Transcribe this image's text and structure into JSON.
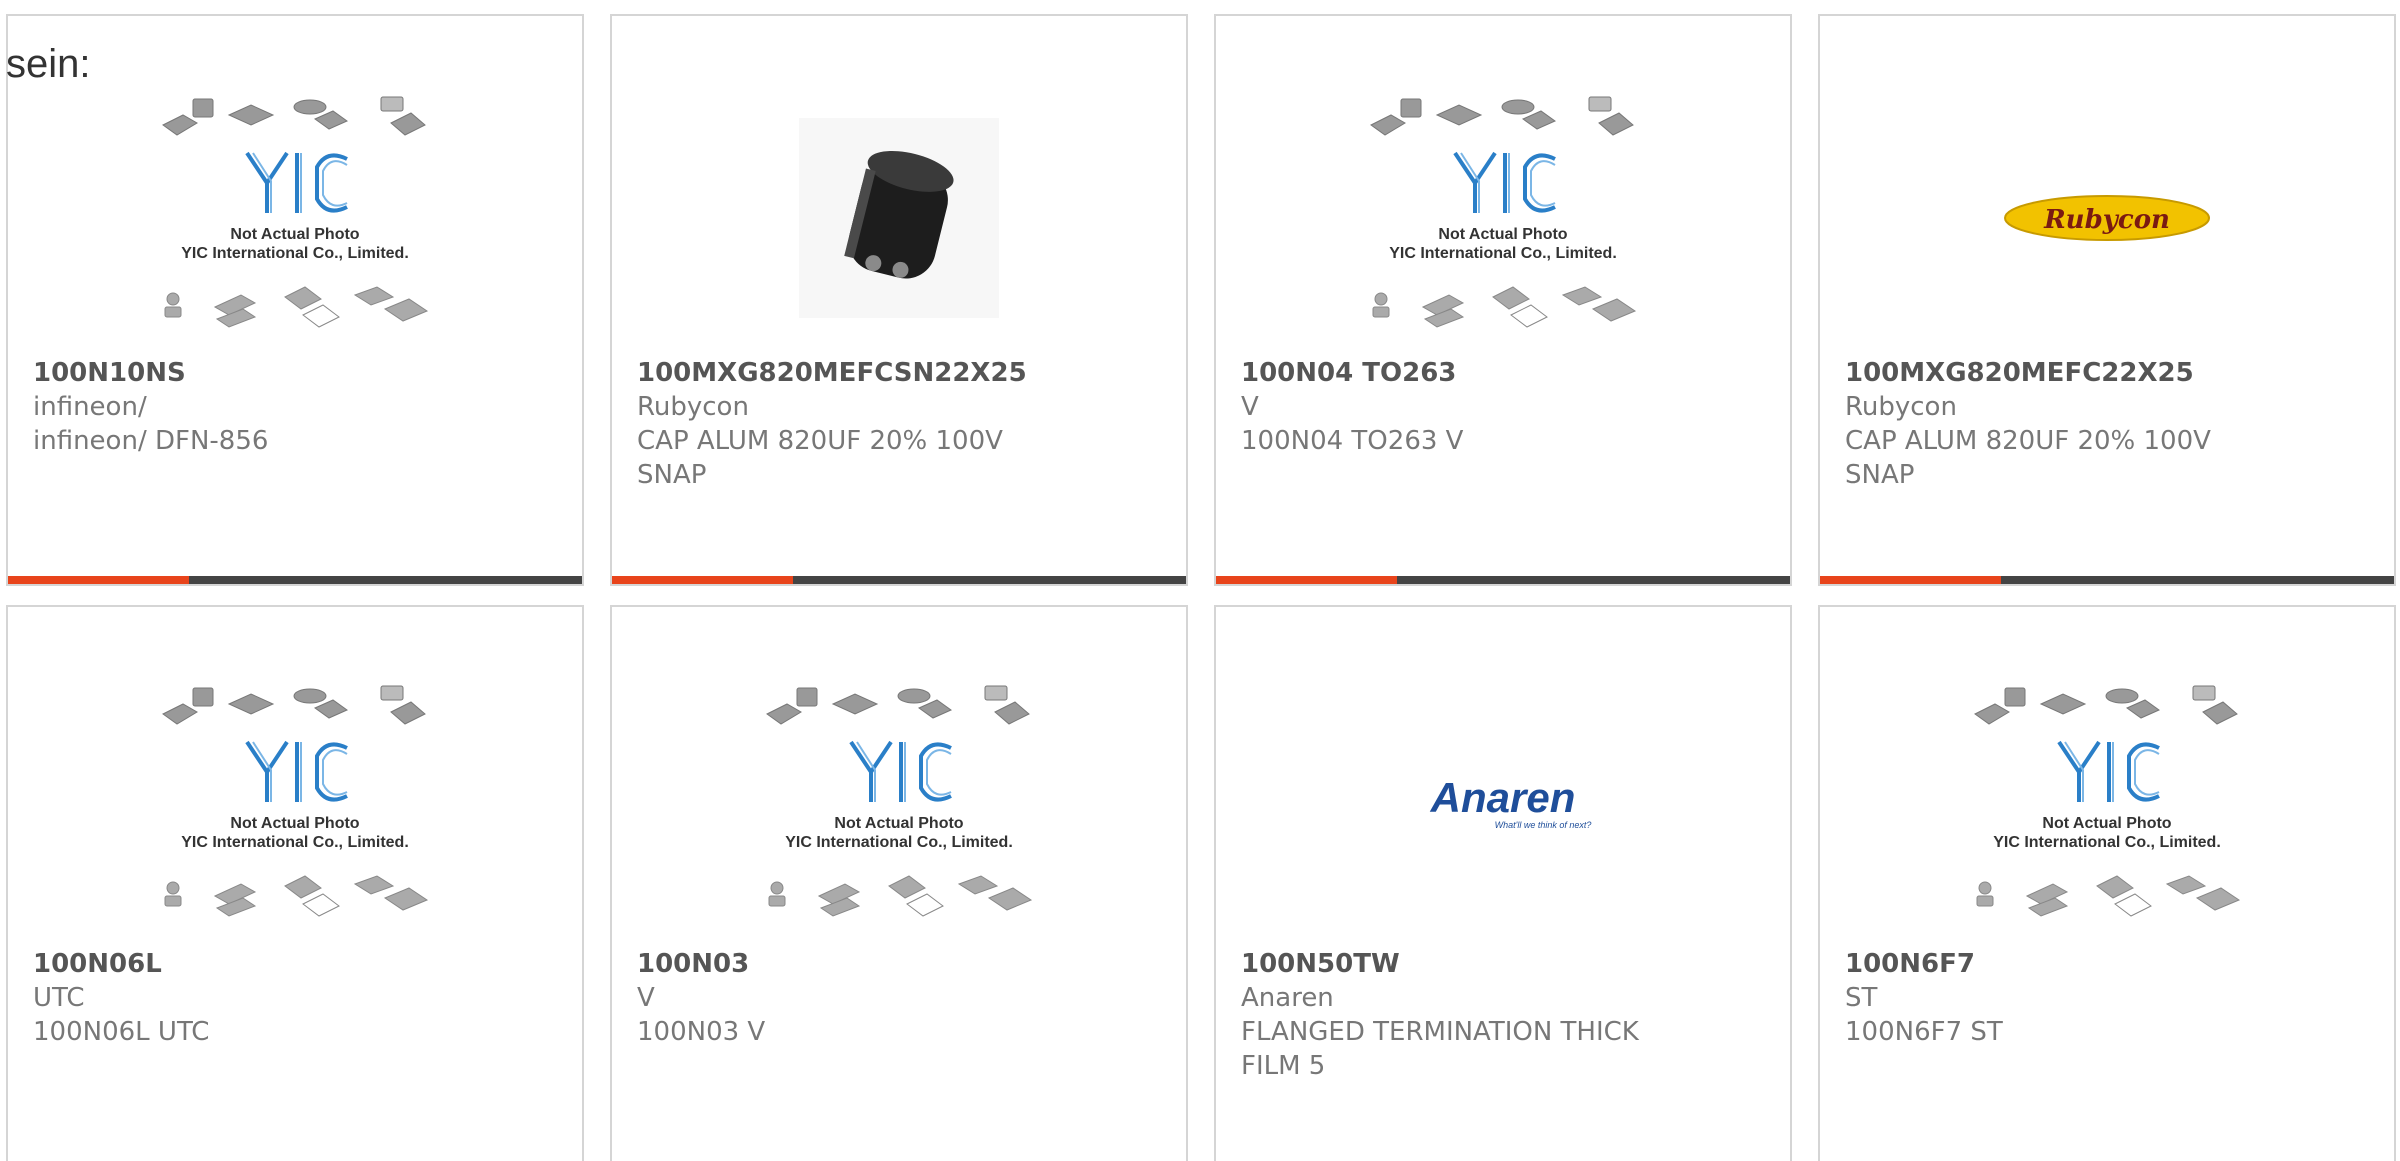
{
  "heading": "sein:",
  "accent_color": "#e8441b",
  "bar_color": "#444444",
  "products": [
    {
      "part_number": "100N10NS",
      "manufacturer": "infineon/",
      "description": "infineon/ DFN-856",
      "image": "yic-placeholder",
      "image_caption_1": "Not Actual Photo",
      "image_caption_2": "YIC International Co., Limited.",
      "brand_text": "YIC"
    },
    {
      "part_number": "100MXG820MEFCSN22X25",
      "manufacturer": "Rubycon",
      "description": "CAP ALUM 820UF 20% 100V SNAP",
      "image": "capacitor-photo"
    },
    {
      "part_number": "100N04 TO263",
      "manufacturer": "V",
      "description": "100N04 TO263 V",
      "image": "yic-placeholder",
      "image_caption_1": "Not Actual Photo",
      "image_caption_2": "YIC International Co., Limited.",
      "brand_text": "YIC"
    },
    {
      "part_number": "100MXG820MEFC22X25",
      "manufacturer": "Rubycon",
      "description": "CAP ALUM 820UF 20% 100V SNAP",
      "image": "rubycon-logo",
      "brand_text": "Rubycon"
    },
    {
      "part_number": "100N06L",
      "manufacturer": "UTC",
      "description": "100N06L UTC",
      "image": "yic-placeholder",
      "image_caption_1": "Not Actual Photo",
      "image_caption_2": "YIC International Co., Limited.",
      "brand_text": "YIC"
    },
    {
      "part_number": "100N03",
      "manufacturer": "V",
      "description": "100N03 V",
      "image": "yic-placeholder",
      "image_caption_1": "Not Actual Photo",
      "image_caption_2": "YIC International Co., Limited.",
      "brand_text": "YIC"
    },
    {
      "part_number": "100N50TW",
      "manufacturer": "Anaren",
      "description": "FLANGED TERMINATION THICK FILM 5",
      "image": "anaren-logo",
      "brand_text": "Anaren",
      "brand_tagline": "What'll we think of next?"
    },
    {
      "part_number": "100N6F7",
      "manufacturer": "ST",
      "description": "100N6F7 ST",
      "image": "yic-placeholder",
      "image_caption_1": "Not Actual Photo",
      "image_caption_2": "YIC International Co., Limited.",
      "brand_text": "YIC"
    }
  ]
}
